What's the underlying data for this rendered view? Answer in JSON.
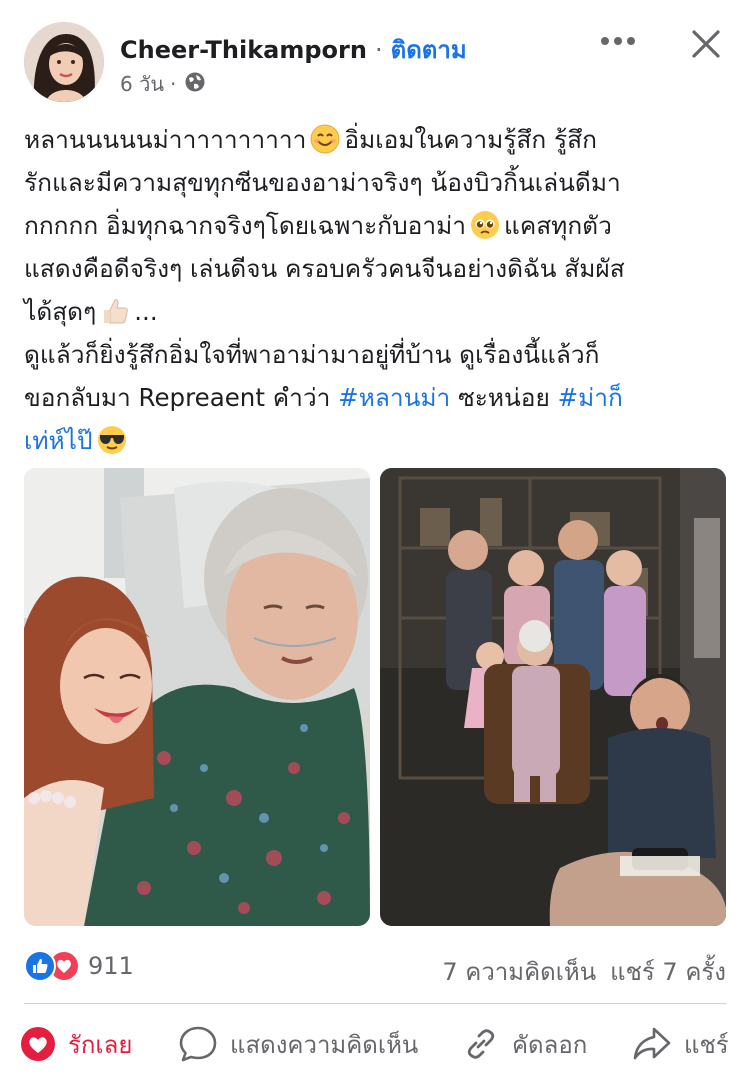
{
  "post": {
    "author": "Cheer-Thikamporn",
    "separator": "·",
    "follow_label": "ติดตาม",
    "time": "6 วัน",
    "meta_separator": "·",
    "privacy_icon": "globe-icon"
  },
  "text": {
    "l1a": "หลานนนนนม่าาาาาาาาาา",
    "l1b": "อิ่มเอมในความรู้สึก รู้สึก",
    "l2": "รักและมีความสุขทุกซีนของอาม่าจริงๆ น้องบิวกิ้นเล่นดีมา",
    "l3a": "กกกกก อิ่มทุกฉากจริงๆโดยเฉพาะกับอาม่า",
    "l3b": "แคสทุกตัว",
    "l4": "แสดงคือดีจริงๆ เล่นดีจน ครอบครัวคนจีนอย่างดิฉัน สัมผัส",
    "l5a": "ได้สุดๆ",
    "l5b": "...",
    "l6": " ดูแล้วก็ยิ่งรู้สึกอิ่มใจที่พาอาม่ามาอยู่ที่บ้าน ดูเรื่องนี้แล้วก็",
    "l7a": "ขอกลับมา Repreaent คำว่า ",
    "hashtag1": "#หลานม่า",
    "l7b": " ซะหน่อย ",
    "hashtag2a": "#ม่าก็",
    "hashtag2b": "เท่ห์ไป๊"
  },
  "stats": {
    "reaction_count": "911",
    "comments": "7 ความคิดเห็น",
    "shares": "แชร์ 7 ครั้ง"
  },
  "actions": {
    "like": "รักเลย",
    "comment": "แสดงความคิดเห็น",
    "copy": "คัดลอก",
    "share": "แชร์"
  },
  "colors": {
    "link": "#1b74e4",
    "secondary_text": "#65676b",
    "love": "#e41e3f",
    "like_reaction": "#1b74e4",
    "love_reaction": "#f33e58"
  }
}
